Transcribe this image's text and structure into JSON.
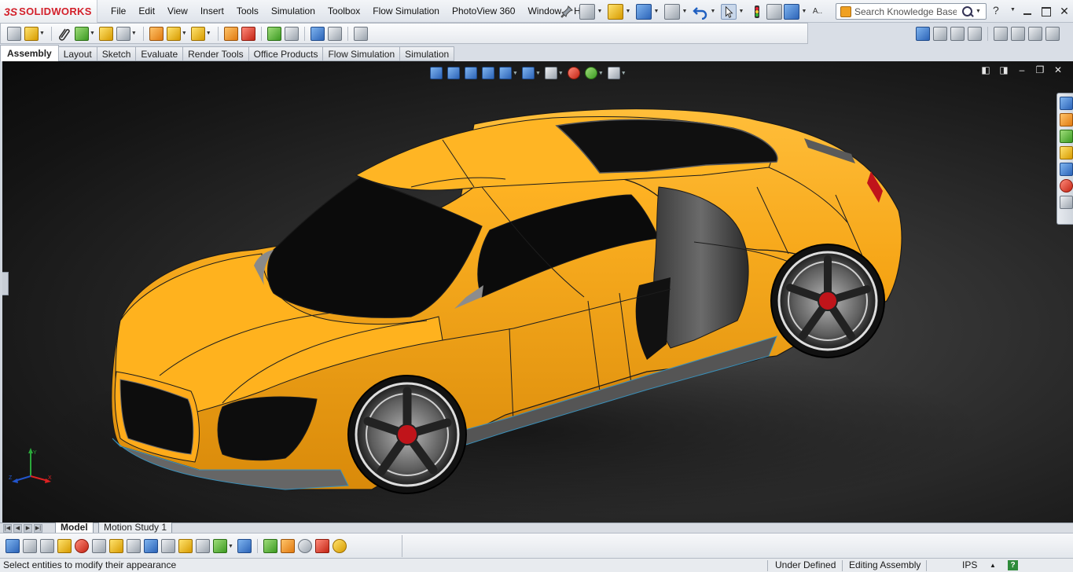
{
  "app": {
    "logo_mark": "3S",
    "logo_text": "SOLIDWORKS"
  },
  "menu": {
    "items": [
      "File",
      "Edit",
      "View",
      "Insert",
      "Tools",
      "Simulation",
      "Toolbox",
      "Flow Simulation",
      "PhotoView 360",
      "Window",
      "Help"
    ]
  },
  "search": {
    "placeholder": "Search Knowledge Base"
  },
  "help_glyph": "?",
  "command_tabs": [
    "Assembly",
    "Layout",
    "Sketch",
    "Evaluate",
    "Render Tools",
    "Office Products",
    "Flow Simulation",
    "Simulation"
  ],
  "active_command_tab": "Assembly",
  "bottom_tabs": [
    "Model",
    "Motion Study 1"
  ],
  "active_bottom_tab": "Model",
  "status": {
    "message": "Select entities to modify their appearance",
    "definition": "Under Defined",
    "mode": "Editing Assembly",
    "units": "IPS",
    "help_glyph": "?"
  },
  "colors": {
    "car_body": "#f5a313",
    "car_body_shadow": "#c97a06",
    "glass": "#0b0b0b",
    "trim": "#5a5a5a",
    "brand_red": "#d3202a"
  },
  "triad_labels": {
    "x": "X",
    "y": "Y",
    "z": "Z"
  }
}
